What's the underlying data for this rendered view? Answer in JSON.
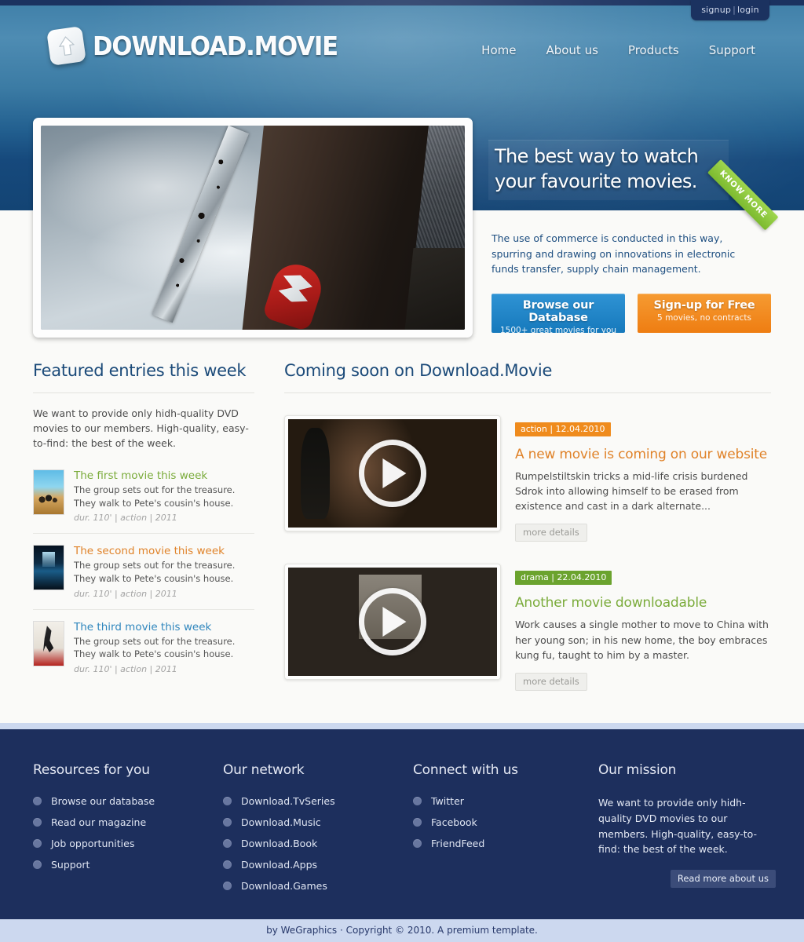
{
  "topbar": {
    "signup_label": "signup",
    "separator": "|",
    "login_label": "login"
  },
  "brand": {
    "name": "DOWNLOAD.MOVIE",
    "logo_icon": "upload-arrow-icon"
  },
  "nav": {
    "items": [
      {
        "label": "Home"
      },
      {
        "label": "About us"
      },
      {
        "label": "Products"
      },
      {
        "label": "Support"
      }
    ]
  },
  "hero": {
    "headline": "The best way to watch your favourite movies.",
    "ribbon_label": "KNOW MORE",
    "description": "The use of commerce is conducted in this way, spurring and drawing on innovations in electronic funds transfer, supply chain management.",
    "cta": [
      {
        "title": "Browse our Database",
        "sub": "1500+ great movies for you",
        "color": "#1679bc"
      },
      {
        "title": "Sign-up for Free",
        "sub": "5 movies, no contracts",
        "color": "#ee7d12"
      }
    ]
  },
  "featured": {
    "title": "Featured entries this week",
    "intro": "We want to provide only hidh-quality DVD movies to our members. High-quality, easy-to-find: the best of the week.",
    "items": [
      {
        "title": "The first movie this week",
        "desc": "The group sets out for the treasure. They walk to Pete's cousin's house.",
        "meta": "dur. 110' | action | 2011",
        "color": "#7aab3a"
      },
      {
        "title": "The second movie this week",
        "desc": "The group sets out for the treasure. They walk to Pete's cousin's house.",
        "meta": "dur. 110' | action | 2011",
        "color": "#e0832a"
      },
      {
        "title": "The third movie this week",
        "desc": "The group sets out for the treasure. They walk to Pete's cousin's house.",
        "meta": "dur. 110' | action | 2011",
        "color": "#2f86bd"
      }
    ]
  },
  "coming_soon": {
    "title": "Coming soon on Download.Movie",
    "entries": [
      {
        "badge": "action | 12.04.2010",
        "badge_color": "#ef8b1d",
        "title": "A new movie is coming on our website",
        "desc": "Rumpelstiltskin tricks a mid-life crisis burdened Sdrok into allowing himself to be erased from existence and cast in a dark alternate...",
        "button": "more details"
      },
      {
        "badge": "drama | 22.04.2010",
        "badge_color": "#6ba32e",
        "title": "Another movie downloadable",
        "desc": "Work causes a single mother to move to China with her young son; in his new home, the boy embraces kung fu, taught to him by a master.",
        "button": "more details"
      }
    ]
  },
  "footer": {
    "columns": [
      {
        "heading": "Resources for you",
        "links": [
          "Browse our database",
          "Read our magazine",
          "Job opportunities",
          "Support"
        ]
      },
      {
        "heading": "Our network",
        "links": [
          "Download.TvSeries",
          "Download.Music",
          "Download.Book",
          "Download.Apps",
          "Download.Games"
        ]
      },
      {
        "heading": "Connect with us",
        "links": [
          "Twitter",
          "Facebook",
          "FriendFeed"
        ]
      }
    ],
    "mission": {
      "heading": "Our mission",
      "text": "We want to provide only hidh-quality DVD movies to our members. High-quality, easy-to-find: the best of the week.",
      "button": "Read more about us"
    }
  },
  "copyright": "by WeGraphics · Copyright © 2010. A premium template."
}
